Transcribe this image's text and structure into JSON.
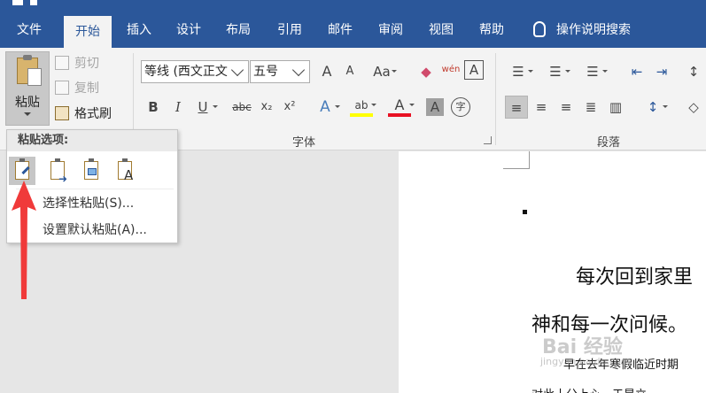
{
  "tabs": [
    {
      "label": "文件"
    },
    {
      "label": "开始",
      "active": true
    },
    {
      "label": "插入"
    },
    {
      "label": "设计"
    },
    {
      "label": "布局"
    },
    {
      "label": "引用"
    },
    {
      "label": "邮件"
    },
    {
      "label": "审阅"
    },
    {
      "label": "视图"
    },
    {
      "label": "帮助"
    }
  ],
  "tell_me": "操作说明搜索",
  "clipboard": {
    "paste_label": "粘贴",
    "cut_label": "剪切",
    "copy_label": "复制",
    "format_painter_label": "格式刷"
  },
  "font": {
    "group_label": "字体",
    "font_name": "等线 (西文正文)",
    "font_size": "五号",
    "grow_label": "A",
    "shrink_label": "A",
    "change_case_label": "Aa",
    "phonetic_label": "wén",
    "border_label": "A",
    "bold": "B",
    "italic": "I",
    "underline": "U",
    "strikethrough": "abc",
    "subscript": "x₂",
    "superscript": "x²",
    "text_effects": "A",
    "highlight": "ab",
    "font_color": "A",
    "shading": "A",
    "enclose": "字",
    "accent_color": "#2b579a",
    "font_color_hex": "#e81123",
    "highlight_hex": "#ffff00"
  },
  "paragraph": {
    "group_label": "段落"
  },
  "paste_menu": {
    "header": "粘贴选项:",
    "icons": [
      "keep-source-formatting-icon",
      "merge-formatting-icon",
      "picture-icon",
      "keep-text-only-icon"
    ],
    "item1": "选择性粘贴(S)...",
    "item2": "设置默认粘贴(A)..."
  },
  "document": {
    "line1": "每次回到家里",
    "line2": "神和每一次问候。",
    "line3": "早在去年寒假临近时期",
    "line4": "对此十分上心，于是立..."
  },
  "watermark": {
    "text": "Bai 经验",
    "sub": "jingyan.baidu.com"
  }
}
